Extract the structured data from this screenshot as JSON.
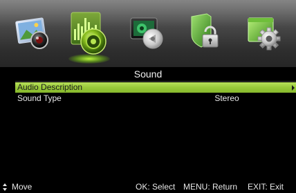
{
  "menu": {
    "tabs": [
      {
        "icon": "picture-icon"
      },
      {
        "icon": "sound-icon",
        "active": true
      },
      {
        "icon": "channel-icon"
      },
      {
        "icon": "lock-icon"
      },
      {
        "icon": "setup-icon"
      }
    ]
  },
  "screen": {
    "title": "Sound",
    "items": [
      {
        "label": "Audio Description",
        "value": "",
        "selected": true
      },
      {
        "label": "Sound Type",
        "value": "Stereo",
        "selected": false
      }
    ]
  },
  "footer": {
    "move": "Move",
    "ok": "OK: Select",
    "menu": "MENU: Return",
    "exit": "EXIT: Exit"
  },
  "colors": {
    "highlight": "#98c93a",
    "background": "#000000",
    "active_glow": "#b6ff3a"
  }
}
